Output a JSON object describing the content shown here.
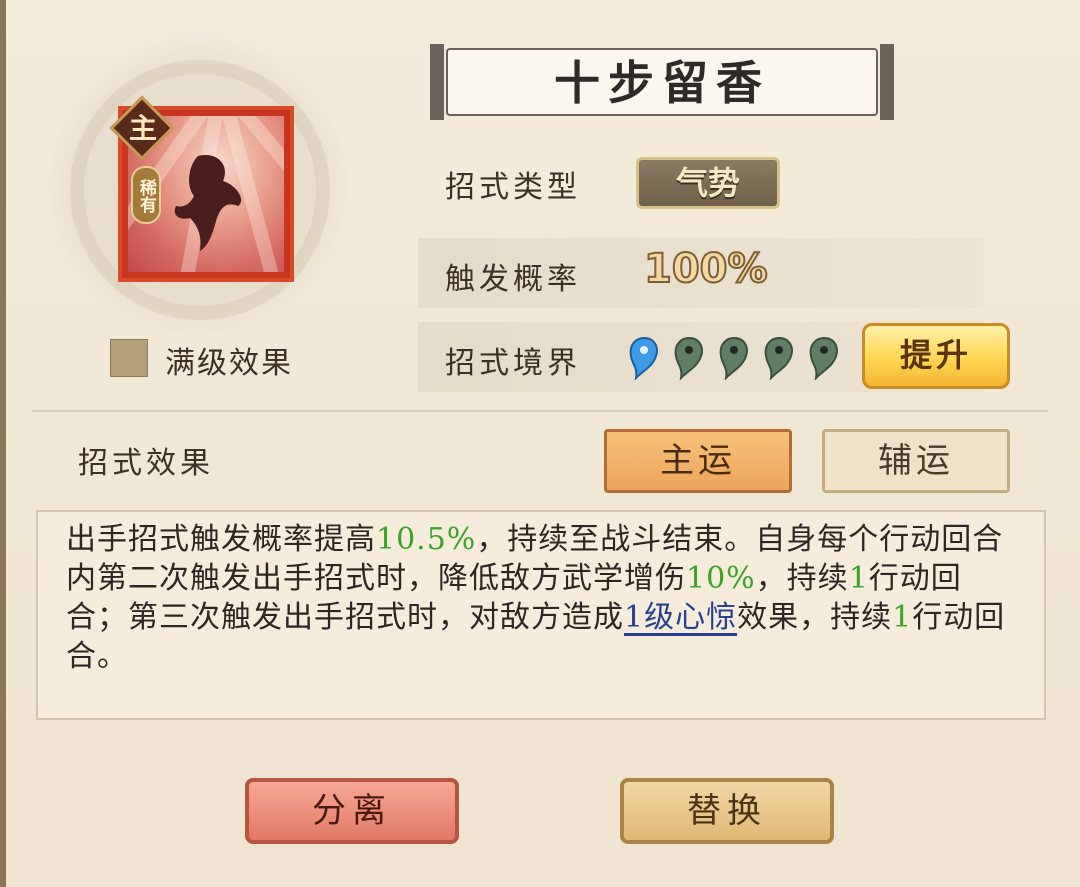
{
  "skill": {
    "name": "十步留香",
    "role_badge": "主",
    "rarity_tag": "稀有",
    "max_effect_label": "满级效果"
  },
  "attributes": {
    "type_label": "招式类型",
    "type_value": "气势",
    "rate_label": "触发概率",
    "rate_value": "100%",
    "realm_label": "招式境界",
    "realm_level": 1,
    "realm_max": 5,
    "upgrade_label": "提升"
  },
  "effect": {
    "label": "招式效果",
    "tab_main": "主运",
    "tab_aux": "辅运",
    "active_tab": "主运",
    "segments": [
      {
        "t": "出手招式触发概率提高",
        "s": "n"
      },
      {
        "t": "10.5%",
        "s": "g"
      },
      {
        "t": "，持续至战斗结束。自身每个行动回合内第二次触发出手招式时，降低敌方武学增伤",
        "s": "n"
      },
      {
        "t": "10%",
        "s": "g"
      },
      {
        "t": "，持续",
        "s": "n"
      },
      {
        "t": "1",
        "s": "g"
      },
      {
        "t": "行动回合；第三次触发出手招式时，对敌方造成",
        "s": "n"
      },
      {
        "t": "1级心惊",
        "s": "l"
      },
      {
        "t": "效果，持续",
        "s": "n"
      },
      {
        "t": "1",
        "s": "g"
      },
      {
        "t": "行动回合。",
        "s": "n"
      }
    ]
  },
  "actions": {
    "split": "分离",
    "swap": "替换"
  },
  "colors": {
    "highlight_green": "#3aa32a",
    "link_blue": "#27408f",
    "realm_active": "#3e9be6",
    "realm_inactive": "#5f7e63"
  }
}
